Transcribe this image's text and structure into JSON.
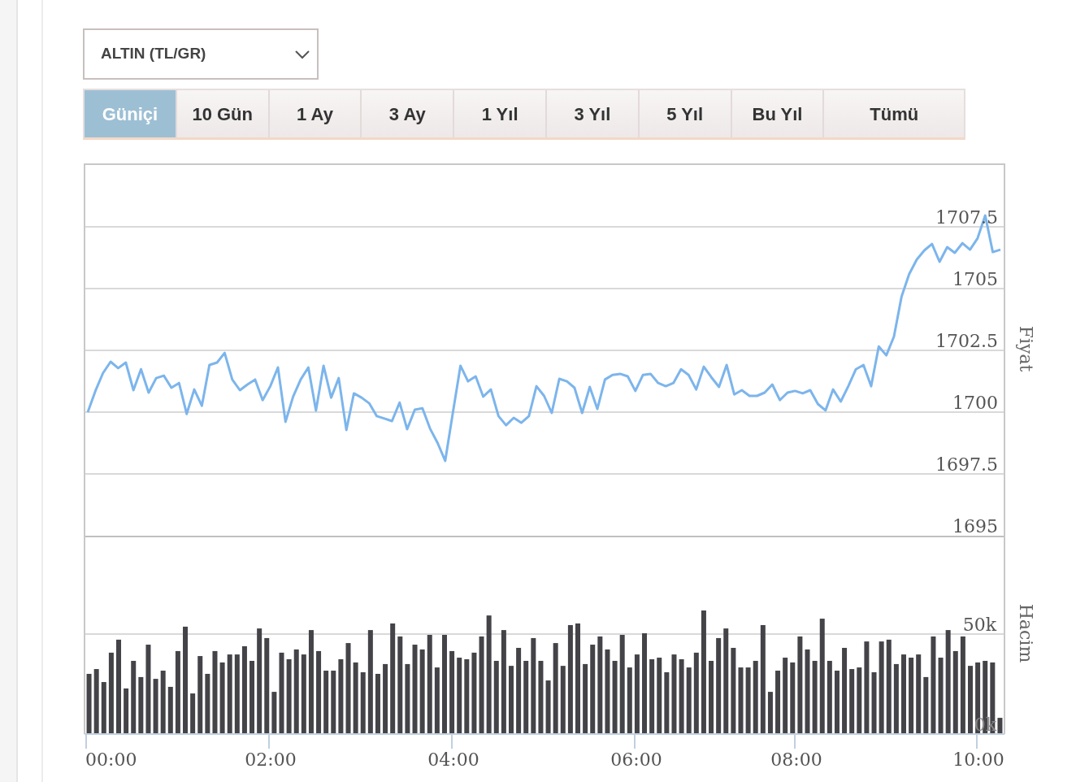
{
  "dropdown": {
    "value": "ALTIN (TL/GR)"
  },
  "tabs": [
    {
      "label": "Güniçi",
      "selected": true
    },
    {
      "label": "10 Gün",
      "selected": false
    },
    {
      "label": "1 Ay",
      "selected": false
    },
    {
      "label": "3 Ay",
      "selected": false
    },
    {
      "label": "1 Yıl",
      "selected": false
    },
    {
      "label": "3 Yıl",
      "selected": false
    },
    {
      "label": "5 Yıl",
      "selected": false
    },
    {
      "label": "Bu Yıl",
      "selected": false
    },
    {
      "label": "Tümü",
      "selected": false
    }
  ],
  "price_chart": {
    "chart_data": {
      "type": "line",
      "ylabel": "Fiyat",
      "grid": true,
      "ylim": [
        1695,
        1710.07
      ],
      "yticks": [
        1695,
        1697.5,
        1700,
        1702.5,
        1705,
        1707.5
      ],
      "series": [
        {
          "color": "#7cb5ec",
          "values": [
            1700.0,
            1700.86,
            1701.58,
            1702.04,
            1701.78,
            1702.01,
            1700.89,
            1701.74,
            1700.79,
            1701.38,
            1701.48,
            1700.99,
            1701.18,
            1699.93,
            1700.92,
            1700.26,
            1701.91,
            1702.01,
            1702.4,
            1701.32,
            1700.89,
            1701.12,
            1701.32,
            1700.49,
            1701.05,
            1701.81,
            1699.61,
            1700.63,
            1701.32,
            1701.81,
            1700.07,
            1701.88,
            1700.59,
            1701.38,
            1699.28,
            1700.76,
            1700.59,
            1700.36,
            1699.84,
            1699.74,
            1699.64,
            1700.39,
            1699.31,
            1700.1,
            1700.16,
            1699.34,
            1698.75,
            1698.03,
            1699.97,
            1701.88,
            1701.25,
            1701.45,
            1700.63,
            1700.92,
            1699.84,
            1699.47,
            1699.77,
            1699.57,
            1699.84,
            1701.05,
            1700.66,
            1699.97,
            1701.35,
            1701.25,
            1700.99,
            1699.97,
            1701.02,
            1700.13,
            1701.32,
            1701.51,
            1701.55,
            1701.45,
            1700.86,
            1701.51,
            1701.55,
            1701.18,
            1701.05,
            1701.18,
            1701.74,
            1701.51,
            1700.92,
            1701.84,
            1701.41,
            1701.02,
            1701.91,
            1700.72,
            1700.89,
            1700.66,
            1700.66,
            1700.79,
            1701.12,
            1700.49,
            1700.79,
            1700.86,
            1700.76,
            1700.89,
            1700.33,
            1700.07,
            1700.92,
            1700.43,
            1701.05,
            1701.74,
            1701.91,
            1701.05,
            1702.66,
            1702.3,
            1703.06,
            1704.67,
            1705.59,
            1706.18,
            1706.55,
            1706.81,
            1706.09,
            1706.68,
            1706.45,
            1706.84,
            1706.58,
            1707.04,
            1707.96,
            1706.48,
            1706.58
          ]
        }
      ]
    }
  },
  "volume_chart": {
    "chart_data": {
      "type": "bar",
      "ylabel": "Hacim",
      "grid": true,
      "ylim": [
        0,
        99.2
      ],
      "yticks": [
        {
          "value": 0,
          "label": "0k"
        },
        {
          "value": 50,
          "label": "50k"
        }
      ],
      "series": [
        {
          "color": "#434348",
          "values": [
            30.1,
            32.5,
            26.0,
            40.7,
            47.2,
            22.8,
            36.6,
            28.5,
            44.7,
            27.6,
            31.7,
            23.6,
            41.5,
            53.7,
            20.3,
            39.0,
            30.1,
            41.5,
            35.8,
            39.8,
            39.8,
            43.9,
            36.6,
            52.8,
            48.0,
            21.1,
            40.7,
            37.4,
            42.3,
            39.8,
            52.0,
            41.5,
            31.7,
            31.7,
            37.4,
            45.5,
            35.8,
            30.9,
            52.0,
            30.1,
            35.0,
            55.3,
            48.8,
            35.0,
            44.7,
            42.3,
            49.6,
            33.3,
            49.6,
            41.5,
            38.2,
            37.4,
            40.7,
            48.8,
            59.3,
            36.6,
            52.0,
            34.1,
            43.1,
            36.6,
            48.0,
            36.6,
            26.8,
            45.5,
            34.1,
            54.5,
            55.3,
            35.0,
            44.7,
            48.8,
            42.3,
            36.6,
            49.6,
            33.3,
            39.8,
            50.4,
            37.4,
            38.2,
            30.9,
            39.8,
            37.4,
            33.3,
            40.7,
            61.8,
            36.6,
            48.0,
            52.8,
            43.1,
            33.3,
            33.3,
            36.6,
            54.5,
            21.1,
            31.7,
            38.2,
            35.8,
            48.8,
            42.3,
            36.6,
            57.7,
            36.6,
            31.7,
            43.1,
            32.5,
            33.3,
            46.3,
            30.9,
            46.3,
            47.2,
            35.0,
            39.8,
            38.2,
            39.8,
            28.5,
            48.8,
            38.2,
            52.0,
            41.5,
            48.8,
            34.1,
            35.8,
            36.6,
            35.8,
            8.1
          ]
        }
      ]
    },
    "time_labels": [
      "00:00",
      "02:00",
      "04:00",
      "06:00",
      "08:00",
      "10:00"
    ]
  }
}
